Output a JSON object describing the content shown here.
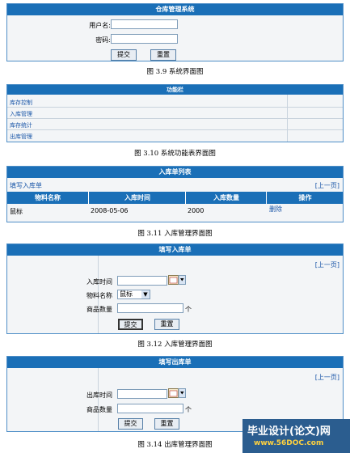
{
  "login": {
    "title": "仓库管理系统",
    "username_label": "用户名:",
    "password_label": "密码:",
    "submit": "提交",
    "reset": "重置",
    "caption": "图 3.9  系统界面图"
  },
  "menu": {
    "title": "功能栏",
    "items": [
      "库存控制",
      "入库管理",
      "库存统计",
      "出库管理"
    ],
    "caption": "图 3.10  系统功能表界面图"
  },
  "inbound_list": {
    "title": "入库单列表",
    "write_link": "填写入库单",
    "prev": "[上一页]",
    "columns": [
      "物料名称",
      "入库时间",
      "入库数量",
      "操作"
    ],
    "rows": [
      [
        "鼠标",
        "2008-05-06",
        "2000",
        "删除"
      ]
    ],
    "caption": "图 3.11  入库管理界面图"
  },
  "inbound_form": {
    "title": "填写入库单",
    "prev": "[上一页]",
    "time_label": "入库时间",
    "material_label": "物料名称",
    "material_value": "鼠标",
    "qty_label": "商品数量",
    "unit": "个",
    "submit": "提交",
    "reset": "重置",
    "caption": "图 3.12  入库管理界面图"
  },
  "outbound_form": {
    "title": "填写出库单",
    "prev": "[上一页]",
    "time_label": "出库时间",
    "qty_label": "商品数量",
    "unit": "个",
    "submit": "提交",
    "reset": "重置",
    "caption": "图 3.14  出库管理界面图"
  },
  "watermark": {
    "line1": "毕业设计(论文)网",
    "line2": "www.56DOC.com"
  }
}
